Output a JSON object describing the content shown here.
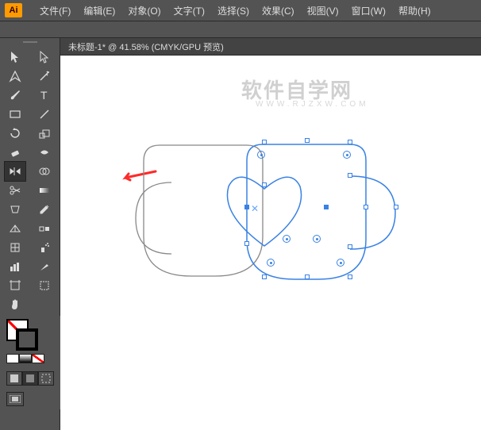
{
  "menubar": {
    "logo": "Ai",
    "items": [
      "文件(F)",
      "编辑(E)",
      "对象(O)",
      "文字(T)",
      "选择(S)",
      "效果(C)",
      "视图(V)",
      "窗口(W)",
      "帮助(H)"
    ]
  },
  "document": {
    "tab_label": "未标题-1* @ 41.58% (CMYK/GPU 预览)"
  },
  "watermark": {
    "main": "软件自学网",
    "sub": "WWW.RJZXW.COM"
  },
  "tools": {
    "left": [
      "selection",
      "pen",
      "paintbrush",
      "shape",
      "rotate",
      "eraser",
      "scissors",
      "free-transform",
      "perspective",
      "mesh",
      "column-graph",
      "artboard",
      "hand",
      "zoom"
    ],
    "right": [
      "direct-selection",
      "magic-wand",
      "type",
      "line",
      "scale",
      "reflect",
      "rubber",
      "gradient",
      "eyedropper",
      "blend",
      "symbol-sprayer",
      "slice",
      "print-tiling",
      "zoom-alt"
    ]
  },
  "colors": {
    "fill": "none",
    "stroke": "#000000"
  }
}
